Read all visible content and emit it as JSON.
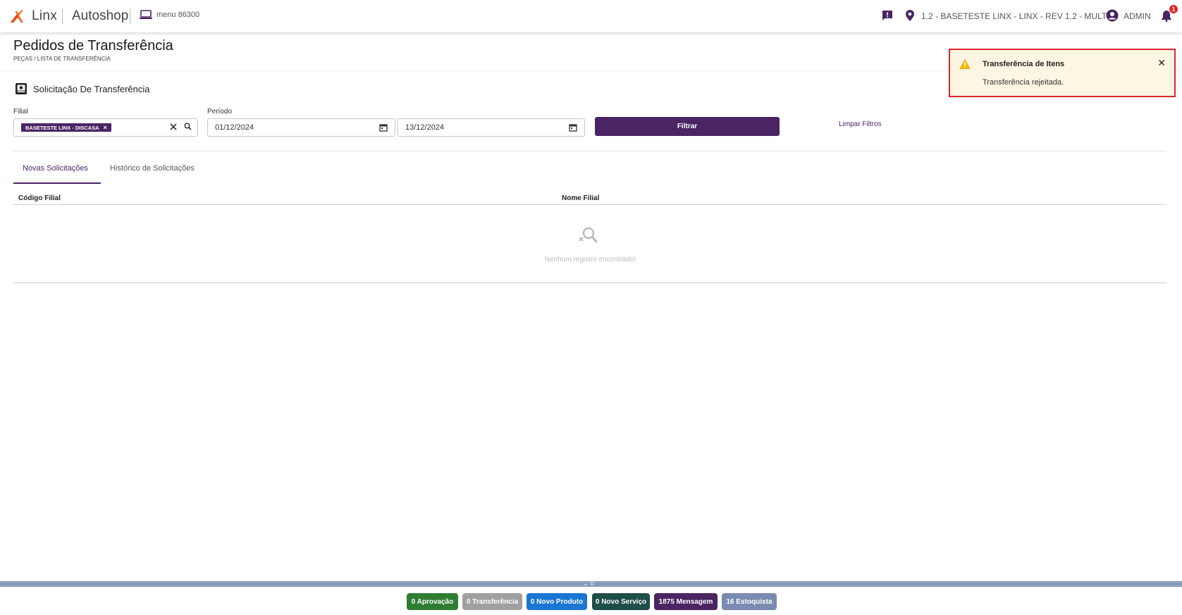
{
  "header": {
    "brand": "Linx",
    "product": "Autoshop",
    "menu_code": "menu 86300",
    "branch": "1.2 - BASETESTE LINX - LINX - REV 1.2 - MULT",
    "user": "ADMIN",
    "notification_count": "1",
    "icons": [
      "linx-logo-icon",
      "monitor-icon",
      "chat-icon",
      "location-pin-icon",
      "user-circle-icon",
      "bell-icon"
    ],
    "accent_color": "#4a2463"
  },
  "page": {
    "title": "Pedidos de Transferência",
    "breadcrumb": "PEÇAS / LISTA DE TRANSFERÊNCIA"
  },
  "section": {
    "title": "Solicitação De Transferência",
    "icon": "image-box-icon"
  },
  "filters": {
    "filial_label": "Filial",
    "filial_chip": "BASETESTE LINX - DISCASA",
    "periodo_label": "Período",
    "date_start": "01/12/2024",
    "date_end": "13/12/2024",
    "filter_button": "Filtrar",
    "clear_button": "Limpar Filtros"
  },
  "tabs": [
    {
      "label": "Novas Solicitações",
      "active": true
    },
    {
      "label": "Histórico de Solicitações",
      "active": false
    }
  ],
  "table": {
    "columns": [
      "Código Filial",
      "Nome Filial"
    ],
    "rows": [],
    "empty_message": "Nenhum registro encontrado!"
  },
  "toast": {
    "title": "Transferência de Itens",
    "message": "Transferência rejeitada.",
    "type": "warning",
    "icon": "warning-triangle-icon"
  },
  "footer": {
    "pills": [
      {
        "label": "0 Aprovação",
        "color": "#2e7d32"
      },
      {
        "label": "0 Transferência",
        "color": "#a0a0a0"
      },
      {
        "label": "0 Novo Produto",
        "color": "#1976d2"
      },
      {
        "label": "0 Novo Serviço",
        "color": "#1e4d4a"
      },
      {
        "label": "1875 Mensagem",
        "color": "#4a2463"
      },
      {
        "label": "16 Estoquista",
        "color": "#7a8ab0"
      }
    ]
  }
}
